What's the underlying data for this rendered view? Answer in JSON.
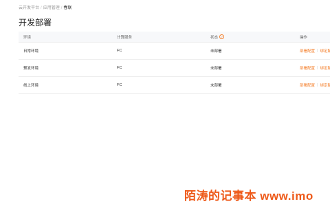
{
  "breadcrumb": {
    "item1": "云开发平台",
    "item2": "应用管理",
    "current": "春联",
    "separator": "/"
  },
  "page_title": "开发部署",
  "table": {
    "headers": {
      "env": "环境",
      "compute": "计算服务",
      "status": "状态",
      "actions": "操作"
    },
    "status_help_icon": "question-circle-icon",
    "rows": [
      {
        "env": "日常环境",
        "compute": "FC",
        "status": "未部署",
        "action1": "部署配置",
        "action2": "绑定配置"
      },
      {
        "env": "预发环境",
        "compute": "FC",
        "status": "未部署",
        "action1": "部署配置",
        "action2": "绑定配置"
      },
      {
        "env": "线上环境",
        "compute": "FC",
        "status": "未部署",
        "action1": "部署配置",
        "action2": "绑定配置"
      }
    ],
    "action_separator": "|"
  },
  "watermark": "陌涛的记事本 www.imo",
  "colors": {
    "accent": "#f47f2b",
    "watermark": "#ee5a1a"
  }
}
